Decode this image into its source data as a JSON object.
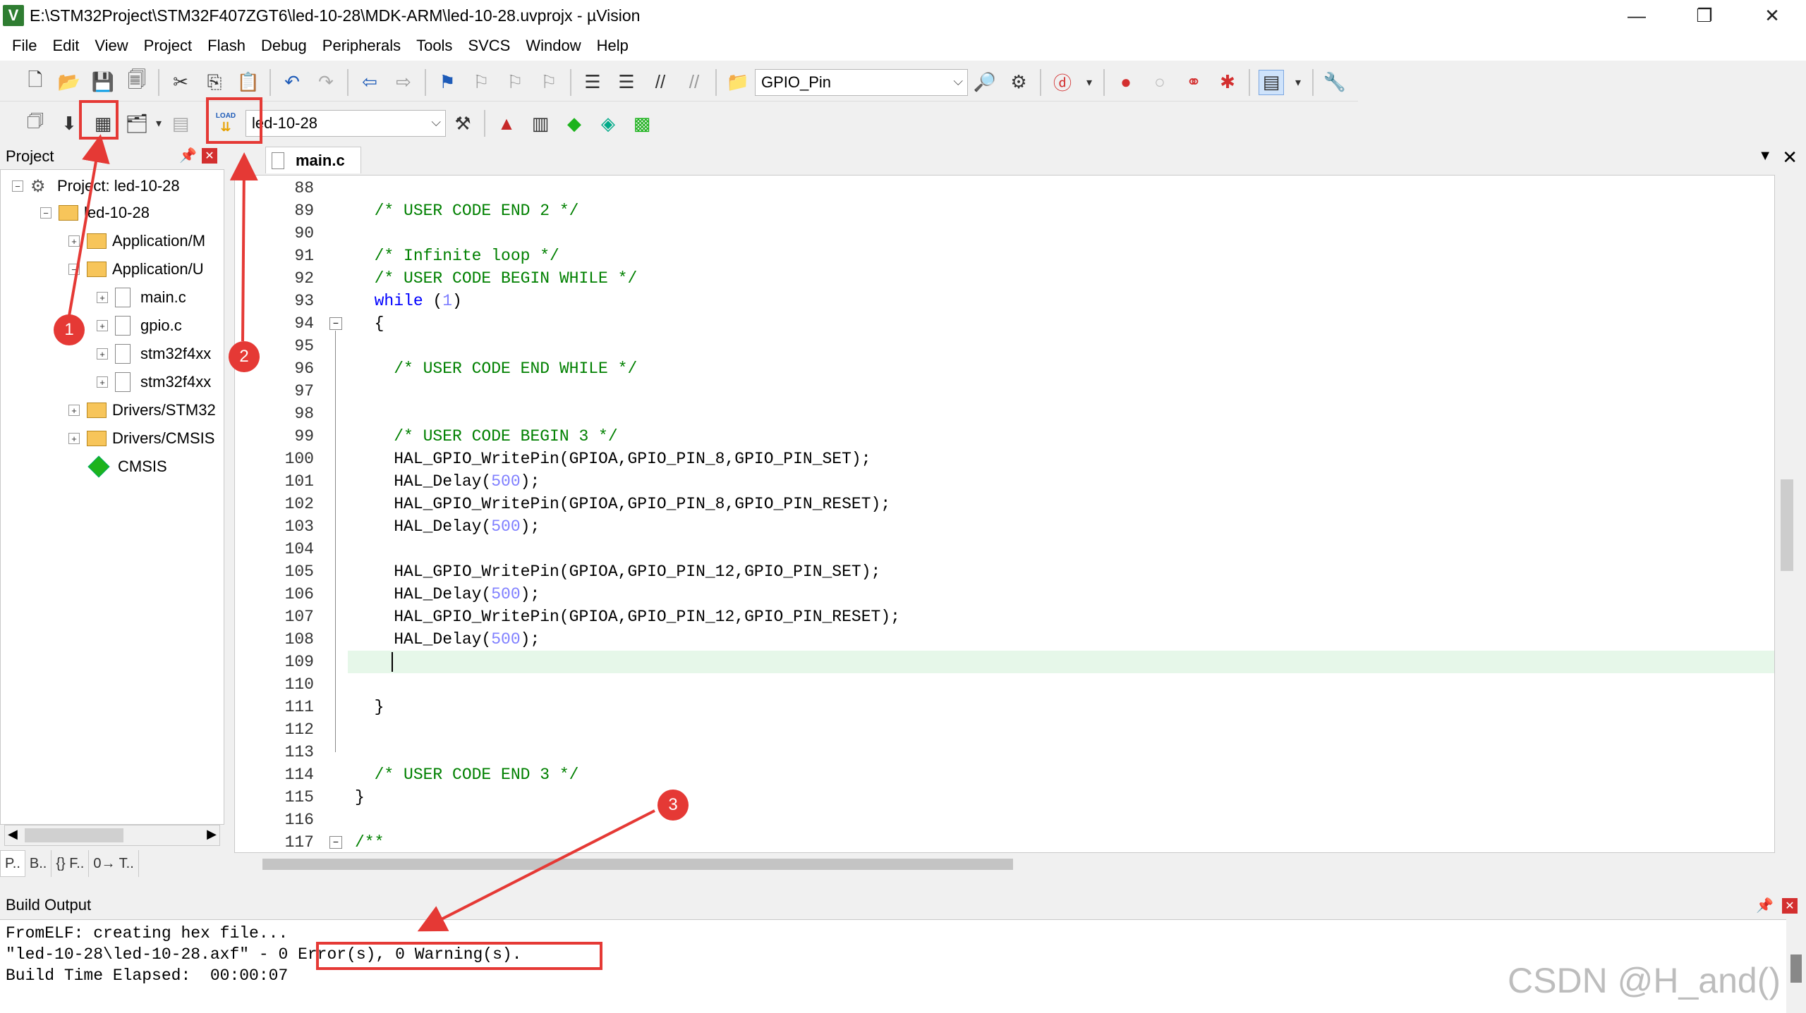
{
  "window": {
    "title": "E:\\STM32Project\\STM32F407ZGT6\\led-10-28\\MDK-ARM\\led-10-28.uvprojx - µVision",
    "app_icon": "V",
    "minimize": "—",
    "maximize": "❐",
    "close": "✕"
  },
  "menu": [
    "File",
    "Edit",
    "View",
    "Project",
    "Flash",
    "Debug",
    "Peripherals",
    "Tools",
    "SVCS",
    "Window",
    "Help"
  ],
  "toolbar": {
    "find_combo_value": "GPIO_Pin",
    "target_combo_value": "led-10-28",
    "load_label": "LOAD"
  },
  "project_panel": {
    "title": "Project",
    "tree": [
      {
        "label": "Project: led-10-28",
        "type": "project"
      },
      {
        "label": "led-10-28",
        "type": "target"
      },
      {
        "label": "Application/M",
        "type": "folder"
      },
      {
        "label": "Application/U",
        "type": "folder"
      },
      {
        "label": "main.c",
        "type": "file"
      },
      {
        "label": "gpio.c",
        "type": "file"
      },
      {
        "label": "stm32f4xx",
        "type": "file"
      },
      {
        "label": "stm32f4xx",
        "type": "file"
      },
      {
        "label": "Drivers/STM32",
        "type": "folder"
      },
      {
        "label": "Drivers/CMSIS",
        "type": "folder"
      },
      {
        "label": "CMSIS",
        "type": "component"
      }
    ],
    "tabs": [
      "P..",
      "B..",
      "{} F..",
      "0→ T.."
    ]
  },
  "editor": {
    "tab": "main.c",
    "lines": [
      {
        "n": "88",
        "text": ""
      },
      {
        "n": "89",
        "text": "  /* USER CODE END 2 */"
      },
      {
        "n": "90",
        "text": ""
      },
      {
        "n": "91",
        "text": "  /* Infinite loop */"
      },
      {
        "n": "92",
        "text": "  /* USER CODE BEGIN WHILE */"
      },
      {
        "n": "93",
        "text": "  while (1)"
      },
      {
        "n": "94",
        "text": "  {"
      },
      {
        "n": "95",
        "text": ""
      },
      {
        "n": "96",
        "text": "    /* USER CODE END WHILE */"
      },
      {
        "n": "97",
        "text": ""
      },
      {
        "n": "98",
        "text": ""
      },
      {
        "n": "99",
        "text": "    /* USER CODE BEGIN 3 */"
      },
      {
        "n": "100",
        "text": "    HAL_GPIO_WritePin(GPIOA,GPIO_PIN_8,GPIO_PIN_SET);"
      },
      {
        "n": "101",
        "text": "    HAL_Delay(500);"
      },
      {
        "n": "102",
        "text": "    HAL_GPIO_WritePin(GPIOA,GPIO_PIN_8,GPIO_PIN_RESET);"
      },
      {
        "n": "103",
        "text": "    HAL_Delay(500);"
      },
      {
        "n": "104",
        "text": ""
      },
      {
        "n": "105",
        "text": "    HAL_GPIO_WritePin(GPIOA,GPIO_PIN_12,GPIO_PIN_SET);"
      },
      {
        "n": "106",
        "text": "    HAL_Delay(500);"
      },
      {
        "n": "107",
        "text": "    HAL_GPIO_WritePin(GPIOA,GPIO_PIN_12,GPIO_PIN_RESET);"
      },
      {
        "n": "108",
        "text": "    HAL_Delay(500);"
      },
      {
        "n": "109",
        "text": ""
      },
      {
        "n": "110",
        "text": ""
      },
      {
        "n": "111",
        "text": "  }"
      },
      {
        "n": "112",
        "text": ""
      },
      {
        "n": "113",
        "text": ""
      },
      {
        "n": "114",
        "text": "  /* USER CODE END 3 */"
      },
      {
        "n": "115",
        "text": "}"
      },
      {
        "n": "116",
        "text": ""
      },
      {
        "n": "117",
        "text": "/**"
      }
    ]
  },
  "build_output": {
    "title": "Build Output",
    "lines": [
      "FromELF: creating hex file...",
      "\"led-10-28\\led-10-28.axf\" - 0 Error(s), 0 Warning(s).",
      "Build Time Elapsed:  00:00:07"
    ]
  },
  "annotations": {
    "badges": [
      "1",
      "2",
      "3"
    ],
    "color": "#e53935"
  },
  "watermark": "CSDN @H_and()"
}
